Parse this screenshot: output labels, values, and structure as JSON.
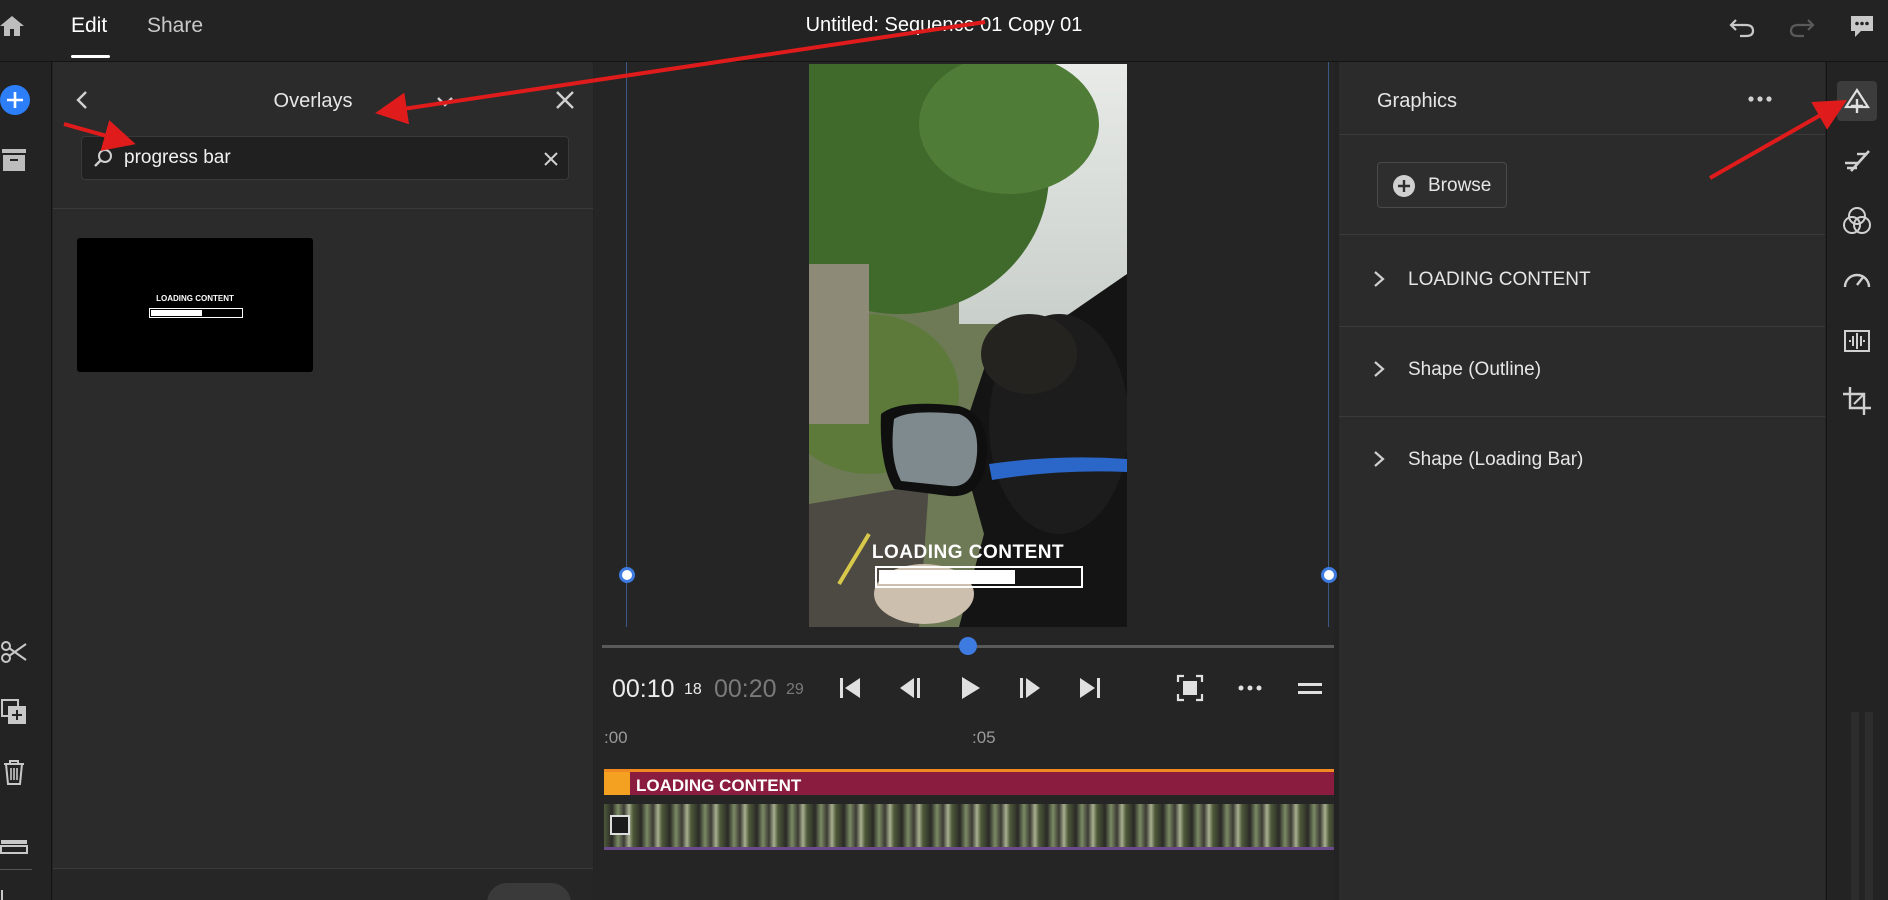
{
  "topbar": {
    "tabs": [
      {
        "label": "Edit",
        "active": true
      },
      {
        "label": "Share",
        "active": false
      }
    ],
    "title": "Untitled: Sequence 01 Copy 01",
    "icons": [
      "home-icon",
      "undo-icon",
      "redo-icon",
      "feedback-icon"
    ]
  },
  "left_rail": {
    "icons": [
      "add-media-icon",
      "media-bin-icon",
      "split-clip-icon",
      "duplicate-icon",
      "delete-icon",
      "track-icon",
      "track-settings-icon"
    ],
    "accent": "#2d7ff9"
  },
  "overlays_panel": {
    "title": "Overlays",
    "search": {
      "value": "progress bar",
      "placeholder": ""
    },
    "results": [
      {
        "title": "LOADING CONTENT",
        "progress": 0.55
      }
    ]
  },
  "preview": {
    "overlay_text": "LOADING CONTENT",
    "progress": 0.68,
    "playhead": 0.5
  },
  "transport": {
    "current_time": "00:10",
    "current_frames": "18",
    "total_time": "00:20",
    "total_frames": "29",
    "buttons": [
      "go-to-start",
      "step-back",
      "play",
      "step-forward",
      "go-to-end",
      "fit-to-screen",
      "more-options",
      "menu"
    ]
  },
  "timeline": {
    "ruler": [
      ":00",
      ":05"
    ],
    "graphics_clip": {
      "label": "LOADING CONTENT",
      "color": "#8a1c40",
      "marker_color": "#f4a020"
    }
  },
  "graphics_panel": {
    "title": "Graphics",
    "browse_label": "Browse",
    "sections": [
      {
        "label": "LOADING CONTENT"
      },
      {
        "label": "Shape (Outline)"
      },
      {
        "label": "Shape (Loading Bar)"
      }
    ]
  },
  "right_rail": {
    "icons": [
      "graphics-icon",
      "effects-icon",
      "color-icon",
      "speed-icon",
      "audio-icon",
      "crop-icon"
    ],
    "active": "graphics-icon"
  },
  "annotation_color": "#e01b1b"
}
